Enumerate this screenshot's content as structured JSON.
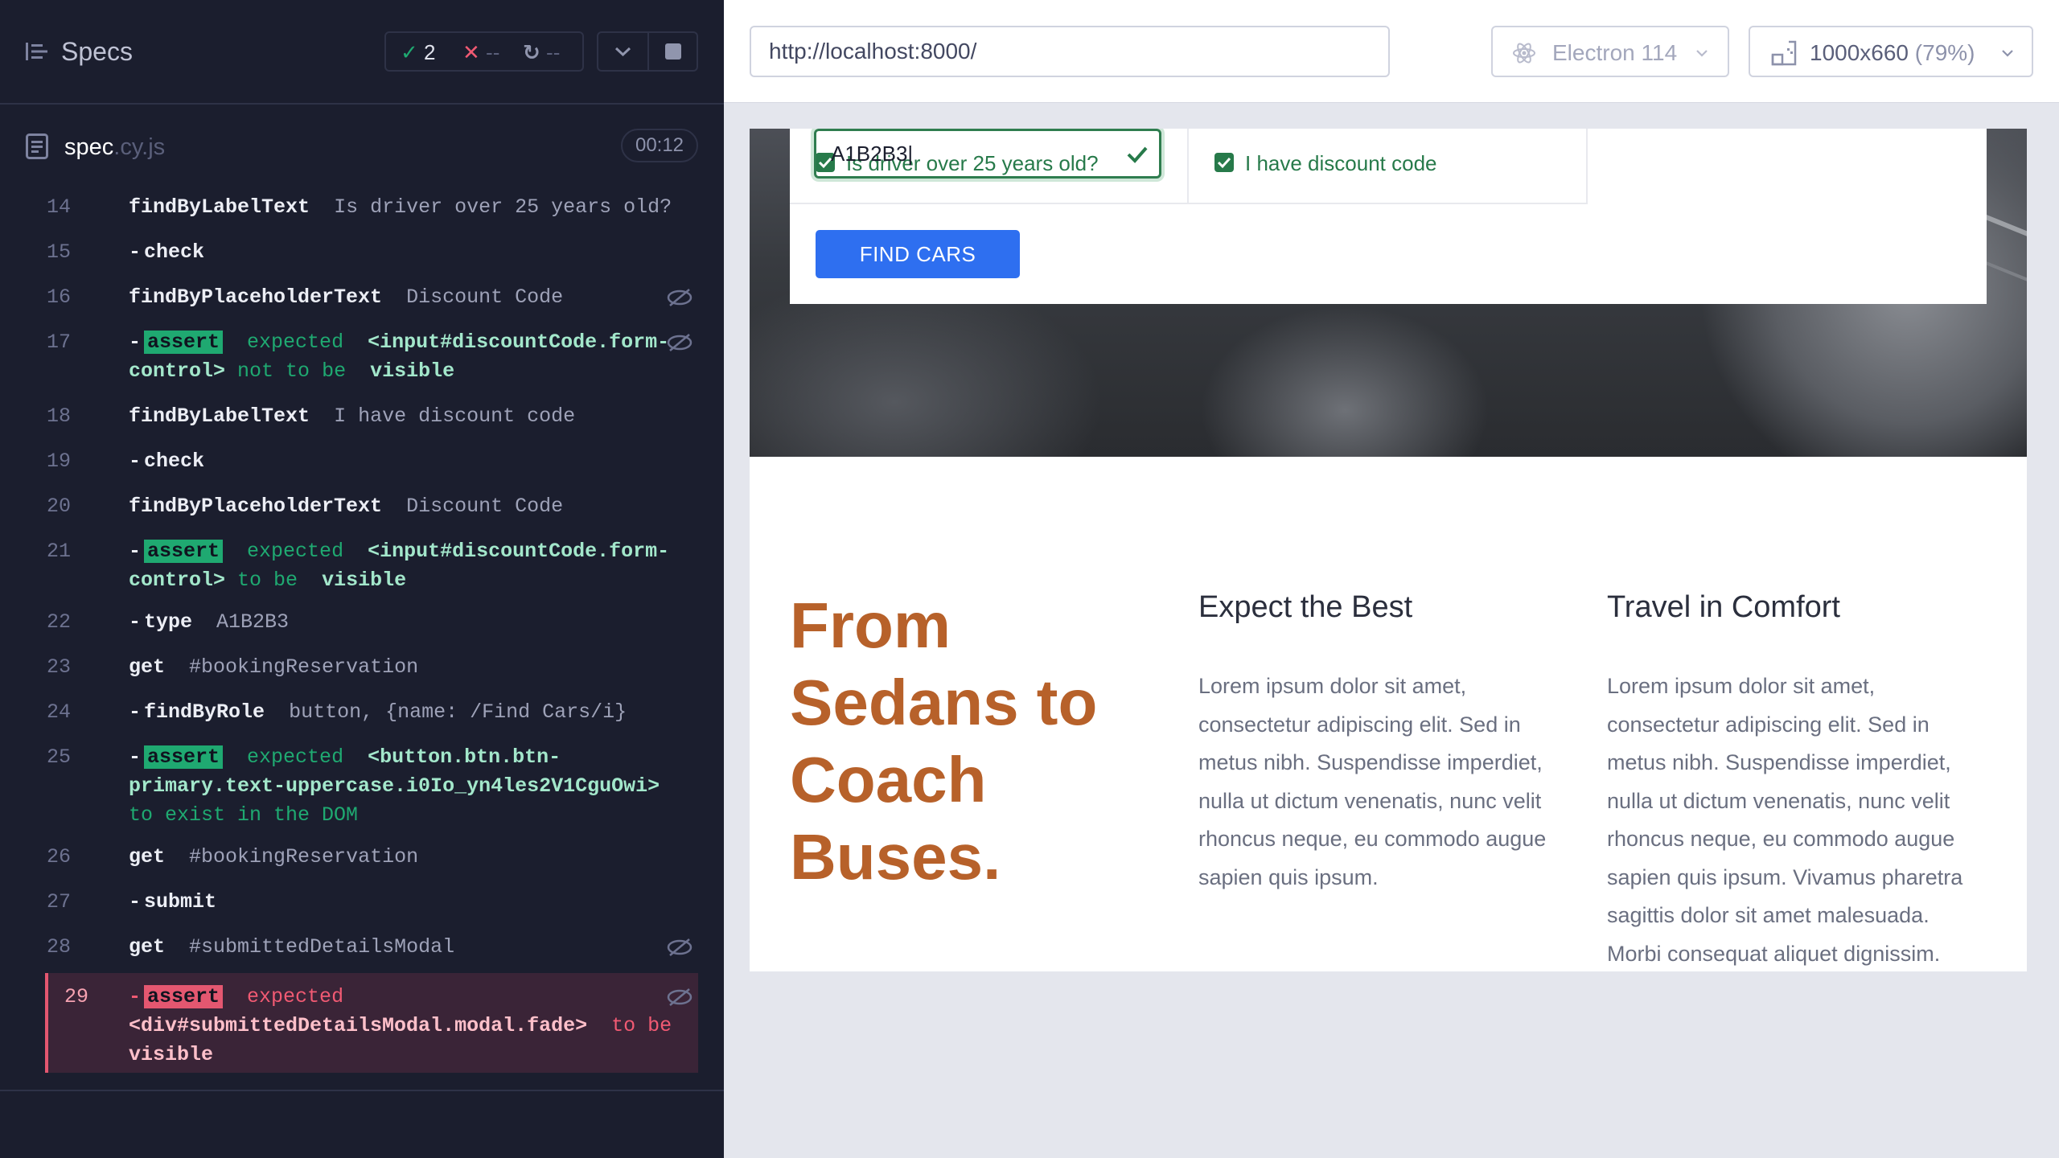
{
  "specs": {
    "title": "Specs",
    "passed": "2",
    "failed": "--",
    "pending": "--"
  },
  "file": {
    "name": "spec",
    "ext": ".cy.js",
    "duration": "00:12"
  },
  "commands": [
    {
      "num": "14",
      "name": "findByLabelText",
      "arg": "Is driver over 25 years old?"
    },
    {
      "num": "15",
      "name": "check"
    },
    {
      "num": "16",
      "name": "findByPlaceholderText",
      "arg": "Discount Code"
    },
    {
      "num": "17",
      "badge": "assert",
      "text1": "expected",
      "bold1": "<input#discountCode.form-control>",
      "text2": "not to be",
      "bold2": "visible"
    },
    {
      "num": "18",
      "name": "findByLabelText",
      "arg": "I have discount code"
    },
    {
      "num": "19",
      "name": "check"
    },
    {
      "num": "20",
      "name": "findByPlaceholderText",
      "arg": "Discount Code"
    },
    {
      "num": "21",
      "badge": "assert",
      "text1": "expected",
      "bold1": "<input#discountCode.form-control>",
      "text2": "to be",
      "bold2": "visible"
    },
    {
      "num": "22",
      "name": "type",
      "arg": "A1B2B3"
    },
    {
      "num": "23",
      "name": "get",
      "arg": "#bookingReservation"
    },
    {
      "num": "24",
      "name": "findByRole",
      "arg": "button, {name: /Find Cars/i}"
    },
    {
      "num": "25",
      "badge": "assert",
      "text1": "expected",
      "bold1": "<button.btn.btn-primary.text-uppercase.i0Io_yn4les2V1CguOwi>",
      "text2": "to exist in the DOM"
    },
    {
      "num": "26",
      "name": "get",
      "arg": "#bookingReservation"
    },
    {
      "num": "27",
      "name": "submit"
    },
    {
      "num": "28",
      "name": "get",
      "arg": "#submittedDetailsModal"
    },
    {
      "num": "29",
      "badge": "assert",
      "text1": "expected",
      "bold1": "<div#submittedDetailsModal.modal.fade>",
      "text2": "to be",
      "bold2": "visible"
    }
  ],
  "toolbar": {
    "url": "http://localhost:8000/",
    "browser": "Electron 114",
    "viewport": "1000x660",
    "zoom": "(79%)"
  },
  "app": {
    "driver_label": "Is driver over 25 years old?",
    "discount_label": "I have discount code",
    "discount_value": "A1B2B3",
    "find_button": "FIND CARS",
    "headline": "From Sedans to Coach Buses.",
    "col1_title": "Expect the Best",
    "col1_text": "Lorem ipsum dolor sit amet, consectetur adipiscing elit. Sed in metus nibh. Suspendisse imperdiet, nulla ut dictum venenatis, nunc velit rhoncus neque, eu commodo augue sapien quis ipsum.",
    "col2_title": "Travel in Comfort",
    "col2_text": "Lorem ipsum dolor sit amet, consectetur adipiscing elit. Sed in metus nibh. Suspendisse imperdiet, nulla ut dictum venenatis, nunc velit rhoncus neque, eu commodo augue sapien quis ipsum. Vivamus pharetra sagittis dolor sit amet malesuada. Morbi consequat aliquet dignissim."
  },
  "colors": {
    "pass": "#1fa971",
    "fail": "#e45770",
    "primary": "#2e6ff0",
    "headline": "#b7612a"
  }
}
